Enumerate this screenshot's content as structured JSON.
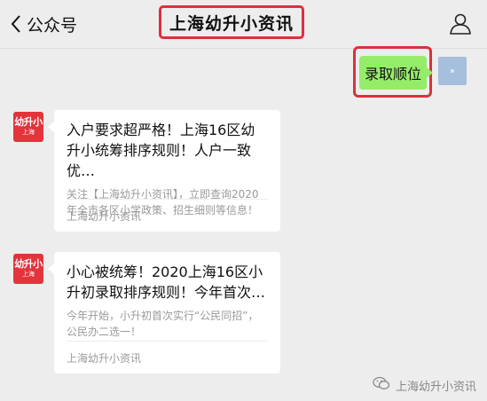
{
  "header": {
    "back_label": "公众号",
    "title": "上海幼升小资讯"
  },
  "sent_message": {
    "text": "录取顺位"
  },
  "account_logo": {
    "top": "幼升小",
    "bottom": "上海"
  },
  "messages": [
    {
      "title": "入户要求超严格！上海16区幼升小统筹排序规则！人户一致优…",
      "description": "关注【上海幼升小资讯】，立即查询2020年全市各区小学政策、招生细则等信息！",
      "source": "上海幼升小资讯"
    },
    {
      "title": "小心被统筹！2020上海16区小升初录取排序规则！今年首次…",
      "description": "今年开始，小升初首次实行“公民同招”，公民办二选一！",
      "source": "上海幼升小资讯"
    }
  ],
  "watermark": {
    "text": "上海幼升小资讯"
  }
}
